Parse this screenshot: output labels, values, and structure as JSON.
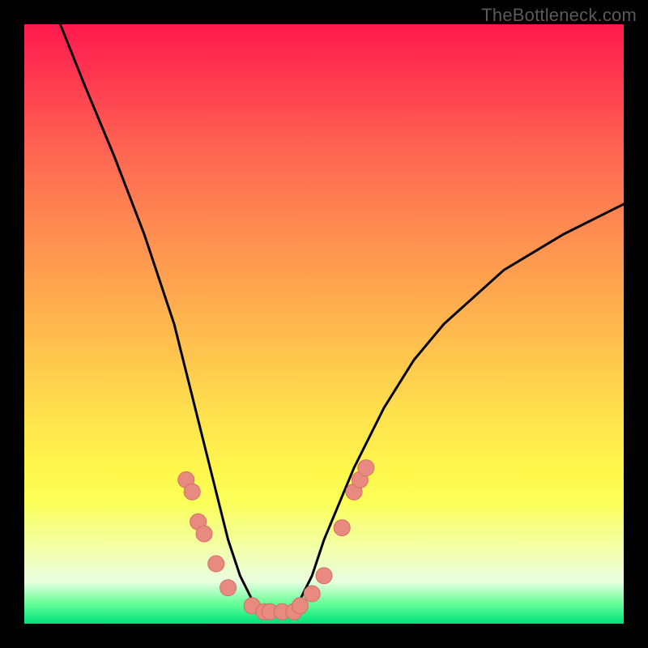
{
  "watermark": "TheBottleneck.com",
  "chart_data": {
    "type": "line",
    "title": "",
    "xlabel": "",
    "ylabel": "",
    "xlim": [
      0,
      100
    ],
    "ylim": [
      0,
      100
    ],
    "grid": false,
    "legend": false,
    "series": [
      {
        "name": "bottleneck-curve",
        "x": [
          6,
          10,
          15,
          20,
          25,
          28,
          30,
          32,
          34,
          36,
          38,
          40,
          42,
          44,
          46,
          48,
          50,
          55,
          60,
          65,
          70,
          80,
          90,
          100
        ],
        "y": [
          100,
          90,
          78,
          65,
          50,
          38,
          30,
          22,
          14,
          8,
          4,
          2,
          2,
          2,
          4,
          8,
          14,
          26,
          36,
          44,
          50,
          59,
          65,
          70
        ]
      }
    ],
    "markers": [
      {
        "x": 27,
        "y": 24
      },
      {
        "x": 28,
        "y": 22
      },
      {
        "x": 29,
        "y": 17
      },
      {
        "x": 30,
        "y": 15
      },
      {
        "x": 32,
        "y": 10
      },
      {
        "x": 34,
        "y": 6
      },
      {
        "x": 38,
        "y": 3
      },
      {
        "x": 40,
        "y": 2
      },
      {
        "x": 41,
        "y": 2
      },
      {
        "x": 43,
        "y": 2
      },
      {
        "x": 45,
        "y": 2
      },
      {
        "x": 46,
        "y": 3
      },
      {
        "x": 48,
        "y": 5
      },
      {
        "x": 50,
        "y": 8
      },
      {
        "x": 53,
        "y": 16
      },
      {
        "x": 55,
        "y": 22
      },
      {
        "x": 56,
        "y": 24
      },
      {
        "x": 57,
        "y": 26
      }
    ],
    "colors": {
      "curve": "#000000",
      "marker_fill": "#e88a80",
      "marker_stroke": "#d46e62"
    }
  }
}
